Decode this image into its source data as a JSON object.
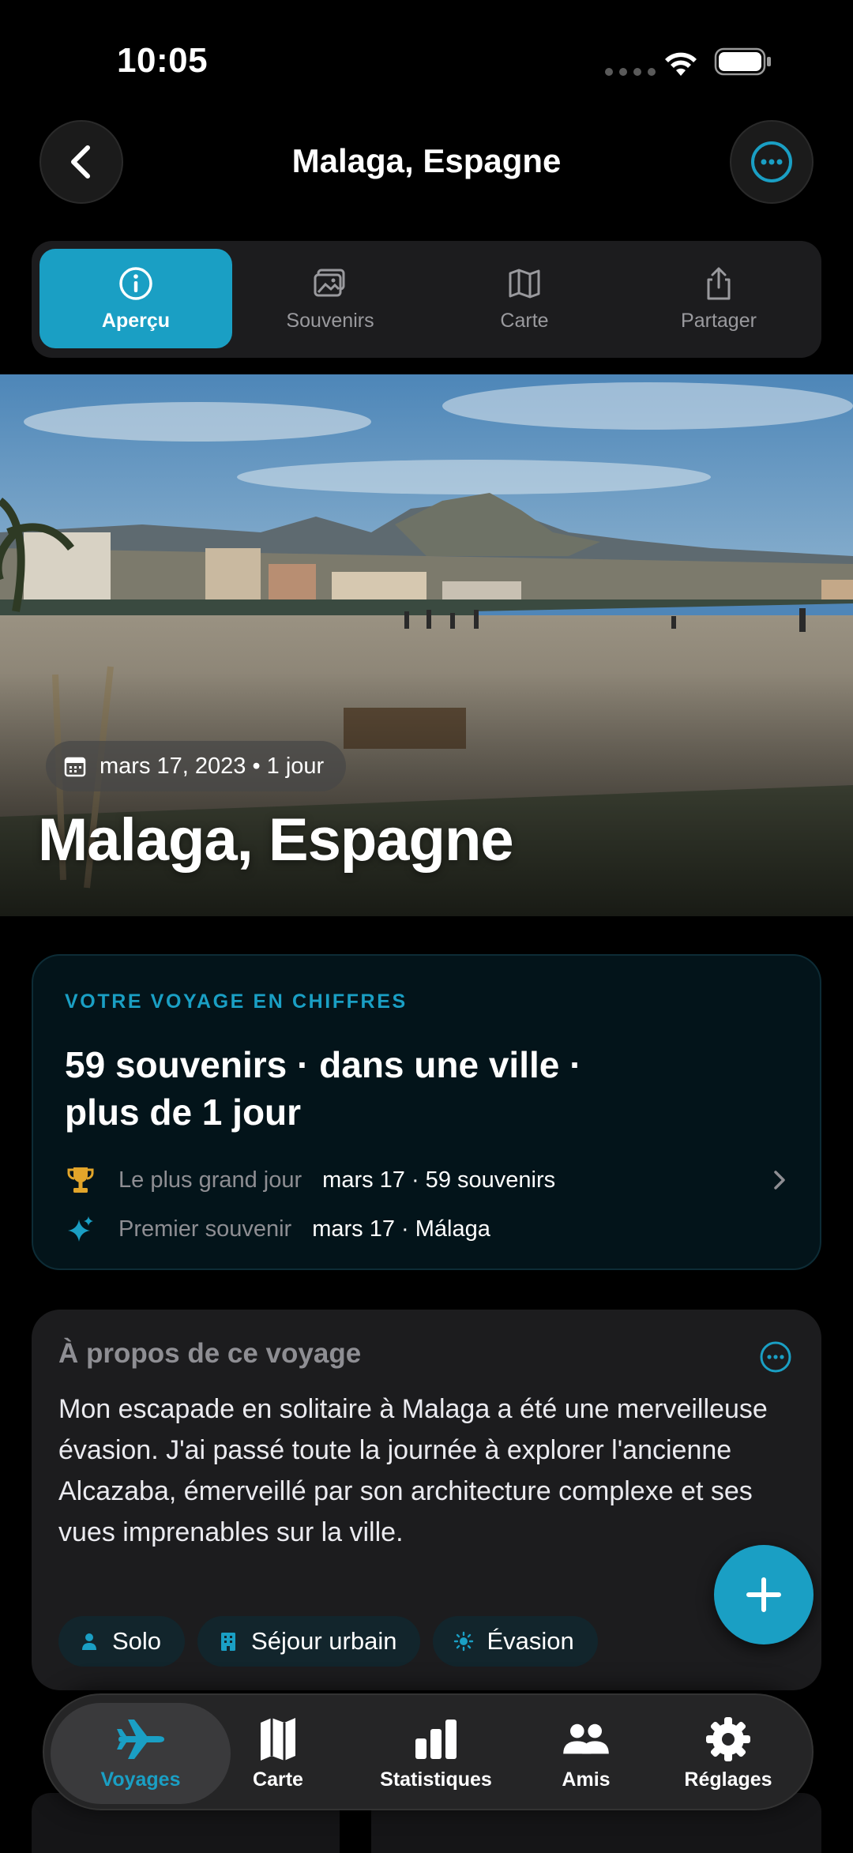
{
  "status_bar": {
    "time": "10:05"
  },
  "header": {
    "title": "Malaga, Espagne"
  },
  "tabs": [
    {
      "label": "Aperçu",
      "icon": "info-icon",
      "active": true
    },
    {
      "label": "Souvenirs",
      "icon": "photos-icon",
      "active": false
    },
    {
      "label": "Carte",
      "icon": "map-icon",
      "active": false
    },
    {
      "label": "Partager",
      "icon": "share-icon",
      "active": false
    }
  ],
  "hero": {
    "date": "mars 17, 2023 • 1 jour",
    "title": "Malaga, Espagne"
  },
  "stats": {
    "heading": "VOTRE VOYAGE EN CHIFFRES",
    "summary_line1": "59 souvenirs · dans une ville ·",
    "summary_line2": "plus de 1 jour",
    "rows": [
      {
        "icon": "trophy-icon",
        "label": "Le plus grand jour",
        "value": "mars 17 · 59 souvenirs"
      },
      {
        "icon": "sparkles-icon",
        "label": "Premier souvenir",
        "value": "mars 17 · Málaga"
      }
    ]
  },
  "about": {
    "title": "À propos de ce voyage",
    "text": "Mon escapade en solitaire à Malaga a été une merveilleuse évasion. J'ai passé toute la journée à explorer l'ancienne Alcazaba, émerveillé par son architecture complexe et ses vues imprenables sur la ville.",
    "tags": [
      {
        "icon": "person-icon",
        "label": "Solo"
      },
      {
        "icon": "building-icon",
        "label": "Séjour urbain"
      },
      {
        "icon": "sun-icon",
        "label": "Évasion"
      }
    ]
  },
  "bottom_nav": [
    {
      "label": "Voyages",
      "icon": "airplane-icon",
      "active": true
    },
    {
      "label": "Carte",
      "icon": "map-icon",
      "active": false
    },
    {
      "label": "Statistiques",
      "icon": "bar-chart-icon",
      "active": false
    },
    {
      "label": "Amis",
      "icon": "people-icon",
      "active": false
    },
    {
      "label": "Réglages",
      "icon": "gear-icon",
      "active": false
    }
  ],
  "colors": {
    "accent": "#1a9fc4",
    "background": "#000000",
    "card": "#1c1c1e",
    "stats_card": "#03141a",
    "trophy": "#e2a52a"
  }
}
